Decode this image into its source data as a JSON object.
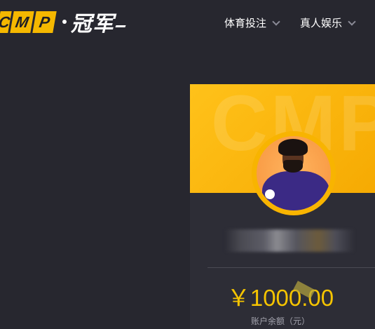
{
  "brand": {
    "tiles": [
      "C",
      "M",
      "P"
    ],
    "chinese": "冠军"
  },
  "nav": {
    "items": [
      {
        "label": "体育投注"
      },
      {
        "label": "真人娱乐"
      }
    ]
  },
  "card": {
    "watermark": "CMP",
    "balance": "￥1000.00",
    "balance_label": "账户余额（元）"
  },
  "colors": {
    "background": "#27272f",
    "accent": "#f5b800",
    "balance": "#f5c400"
  }
}
